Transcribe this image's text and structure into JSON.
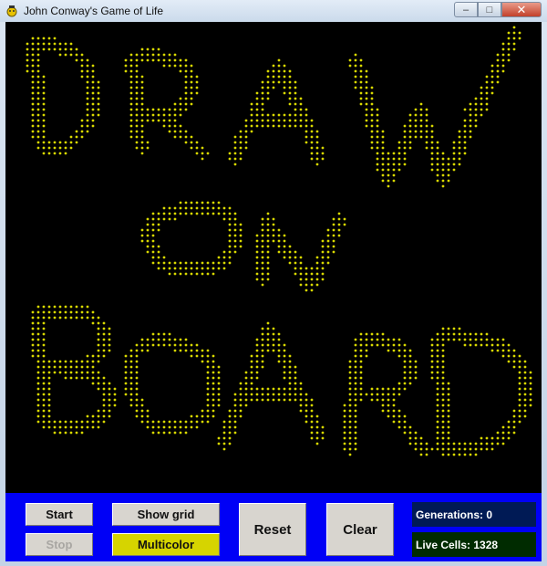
{
  "window": {
    "title": "John Conway's Game of Life",
    "minimize_glyph": "–",
    "maximize_glyph": "□",
    "close_glyph": "✕"
  },
  "board": {
    "background": "#000000",
    "cell_color": "#d8d800",
    "cell_size": 5,
    "pattern_text": "DRAW ON BOARD"
  },
  "controls": {
    "start_label": "Start",
    "stop_label": "Stop",
    "show_grid_label": "Show grid",
    "multicolor_label": "Multicolor",
    "reset_label": "Reset",
    "clear_label": "Clear",
    "panel_color": "#0000f6",
    "multicolor_color": "#d6d400"
  },
  "stats": {
    "generations_label": "Generations: 0",
    "live_cells_label": "Live Cells: 1328"
  },
  "icons": [
    "app-icon",
    "minimize-icon",
    "maximize-icon",
    "close-icon"
  ]
}
